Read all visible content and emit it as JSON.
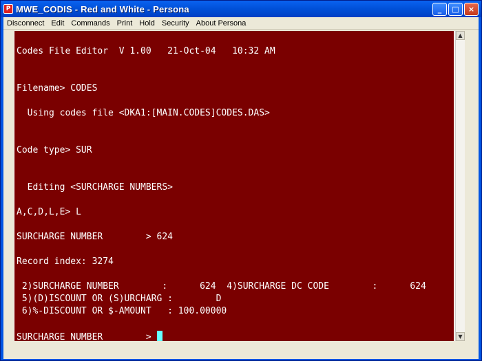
{
  "window": {
    "title": "MWE_CODIS - Red and White - Persona",
    "app_icon": "persona-app-icon",
    "controls": {
      "minimize": "_",
      "maximize": "□",
      "close": "×"
    }
  },
  "menu": {
    "items": [
      "Disconnect",
      "Edit",
      "Commands",
      "Print",
      "Hold",
      "Security",
      "About Persona"
    ]
  },
  "colors": {
    "terminal_bg": "#7a0000",
    "terminal_fg": "#ffffff",
    "cursor": "#66ffff"
  },
  "terminal": {
    "lines": [
      "Codes File Editor  V 1.00   21-Oct-04   10:32 AM",
      "Filename> CODES",
      "  Using codes file <DKA1:[MAIN.CODES]CODES.DAS>",
      "Code type> SUR",
      "  Editing <SURCHARGE NUMBERS>",
      "A,C,D,L,E> L",
      "SURCHARGE NUMBER        > 624",
      "Record index: 3274",
      " 2)SURCHARGE NUMBER        :      624  4)SURCHARGE DC CODE        :      624",
      " 5)(D)ISCOUNT OR (S)URCHARG :        D",
      " 6)%-DISCOUNT OR $-AMOUNT   : 100.00000",
      "SURCHARGE NUMBER        > "
    ]
  }
}
